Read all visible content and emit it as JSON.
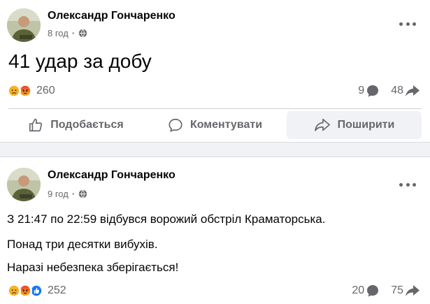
{
  "posts": [
    {
      "author": "Олександр Гончаренко",
      "time": "8 год",
      "separator": "·",
      "text": "41 удар за добу",
      "reactions": {
        "icons": [
          "sad-reaction-icon",
          "angry-reaction-icon"
        ],
        "count": "260"
      },
      "comments": "9",
      "shares": "48",
      "actions": {
        "like": "Подобається",
        "comment": "Коментувати",
        "share": "Поширити"
      }
    },
    {
      "author": "Олександр Гончаренко",
      "time": "9 год",
      "separator": "·",
      "lines": [
        "З 21:47 по 22:59 відбувся ворожий обстріл Краматорська.",
        "Понад три десятки вибухів.",
        "Наразі небезпека зберігається!"
      ],
      "reactions": {
        "icons": [
          "sad-reaction-icon",
          "angry-reaction-icon",
          "like-reaction-icon"
        ],
        "count": "252"
      },
      "comments": "20",
      "shares": "75"
    }
  ],
  "colors": {
    "text": "#050505",
    "secondary": "#65676b",
    "background": "#f0f2f5",
    "like_blue": "#1877f2",
    "sad_yellow": "#f7b125",
    "angry_red": "#e9710f"
  }
}
